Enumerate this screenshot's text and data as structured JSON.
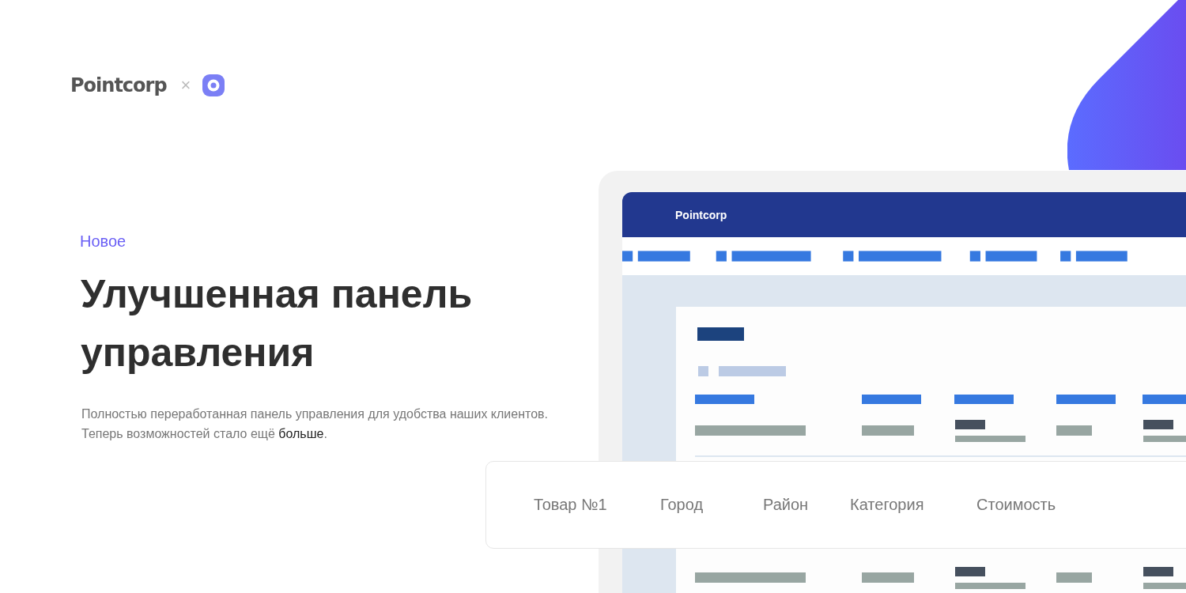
{
  "logo": {
    "brand": "Pointcorp",
    "separator": "×"
  },
  "badge": "Новое",
  "title": "Улучшенная панель управления",
  "description": {
    "text": "Полностью переработанная панель управления для удобства наших клиентов. Теперь возможностей стало ещё ",
    "link": "больше",
    "end": "."
  },
  "mockup": {
    "brand": "Pointcorp"
  },
  "columns_card": {
    "columns": [
      {
        "label": "Товар №1"
      },
      {
        "label": "Город"
      },
      {
        "label": "Район"
      },
      {
        "label": "Категория"
      },
      {
        "label": "Стоимость"
      }
    ]
  }
}
